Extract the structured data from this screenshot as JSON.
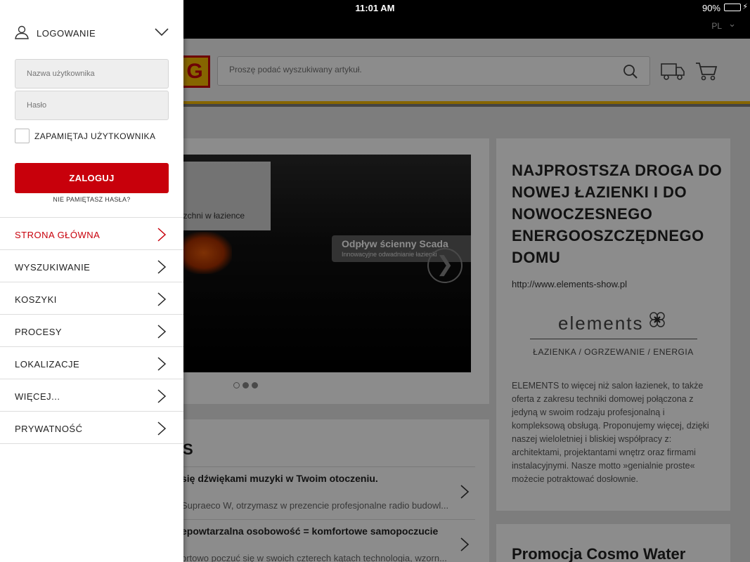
{
  "status_bar": {
    "time": "11:01 AM",
    "battery_percent": "90%",
    "battery_level": 0.9
  },
  "header": {
    "language": "PL",
    "logo_letter": "G",
    "search_placeholder": "Proszę podać wyszukiwany artykuł."
  },
  "slider": {
    "caption_text": "erzchni w łazience",
    "badge_title": "Odpływ ścienny Scada",
    "badge_subtitle": "Innowacyjne odwadnianie łazienki",
    "next_glyph": "❯"
  },
  "news": {
    "heading": "S",
    "items": [
      {
        "title": "się dźwiękami muzyki w Twoim otoczeniu.",
        "text": "Supraeco W, otrzymasz w prezencie profesjonalne radio budowl..."
      },
      {
        "title": "epowtarzalna osobowość = komfortowe samopoczucie",
        "text": "ortowo poczuć się w swoich czterech kątach technologia, wzorn..."
      }
    ]
  },
  "promo": {
    "title": "NAJPROSTSZA DROGA DO NOWEJ ŁAZIENKI I DO NOWOCZESNEGO ENERGOOSZCZĘDNEGO DOMU",
    "url": "http://www.elements-show.pl",
    "logo_text": "elements",
    "tagline": "ŁAZIENKA / OGRZEWANIE / ENERGIA",
    "body": "ELEMENTS to więcej niż salon łazienek, to także oferta z zakresu techniki domowej połączona z jedyną w swoim rodzaju profesjonalną i kompleksową obsługą. Proponujemy więcej, dzięki naszej wieloletniej i bliskiej współpracy z: architektami, projektantami wnętrz oraz firmami instalacyjnymi. Nasze motto »genialnie proste« możecie potraktować dosłownie."
  },
  "promo2": {
    "title": "Promocja Cosmo Water"
  },
  "side_menu": {
    "login_label": "LOGOWANIE",
    "username_placeholder": "Nazwa użytkownika",
    "password_placeholder": "Hasło",
    "remember_label": "ZAPAMIĘTAJ UŻYTKOWNIKA",
    "login_button": "ZALOGUJ",
    "forgot_password": "NIE PAMIĘTASZ HASŁA?",
    "items": [
      {
        "label": "STRONA GŁÓWNA",
        "active": true
      },
      {
        "label": "WYSZUKIWANIE",
        "active": false
      },
      {
        "label": "KOSZYKI",
        "active": false
      },
      {
        "label": "PROCESY",
        "active": false
      },
      {
        "label": "LOKALIZACJE",
        "active": false
      },
      {
        "label": "WIĘCEJ...",
        "active": false
      },
      {
        "label": "PRYWATNOŚĆ",
        "active": false
      }
    ]
  },
  "colors": {
    "brand_red": "#c8000b",
    "brand_yellow": "#f5b800"
  }
}
